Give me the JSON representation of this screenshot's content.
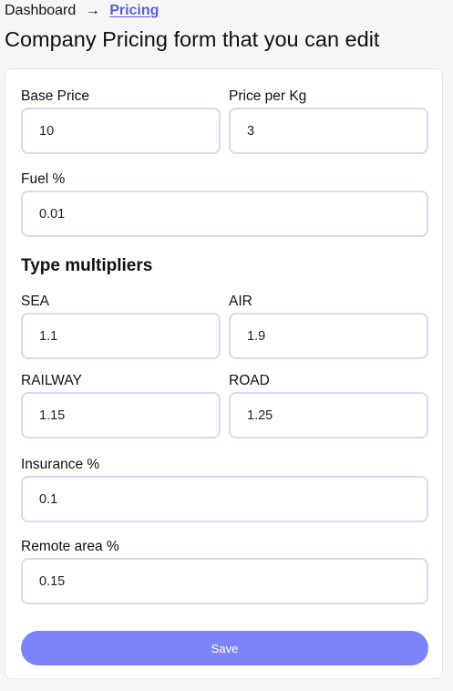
{
  "breadcrumb": {
    "home": "Dashboard",
    "separator": "→",
    "current": "Pricing"
  },
  "page": {
    "title": "Company Pricing form that you can edit"
  },
  "form": {
    "base_price": {
      "label": "Base Price",
      "value": "10"
    },
    "price_per_kg": {
      "label": "Price per Kg",
      "value": "3"
    },
    "fuel": {
      "label": "Fuel %",
      "value": "0.01"
    },
    "type_multipliers": {
      "heading": "Type multipliers",
      "sea": {
        "label": "SEA",
        "value": "1.1"
      },
      "air": {
        "label": "AIR",
        "value": "1.9"
      },
      "railway": {
        "label": "RAILWAY",
        "value": "1.15"
      },
      "road": {
        "label": "ROAD",
        "value": "1.25"
      }
    },
    "insurance": {
      "label": "Insurance %",
      "value": "0.1"
    },
    "remote_area": {
      "label": "Remote area %",
      "value": "0.15"
    },
    "save_label": "Save"
  },
  "colors": {
    "link_accent": "#5b5fd6",
    "button_bg": "#7d83f8",
    "input_border": "#d6d8f5",
    "page_bg": "#f6f6f6"
  }
}
